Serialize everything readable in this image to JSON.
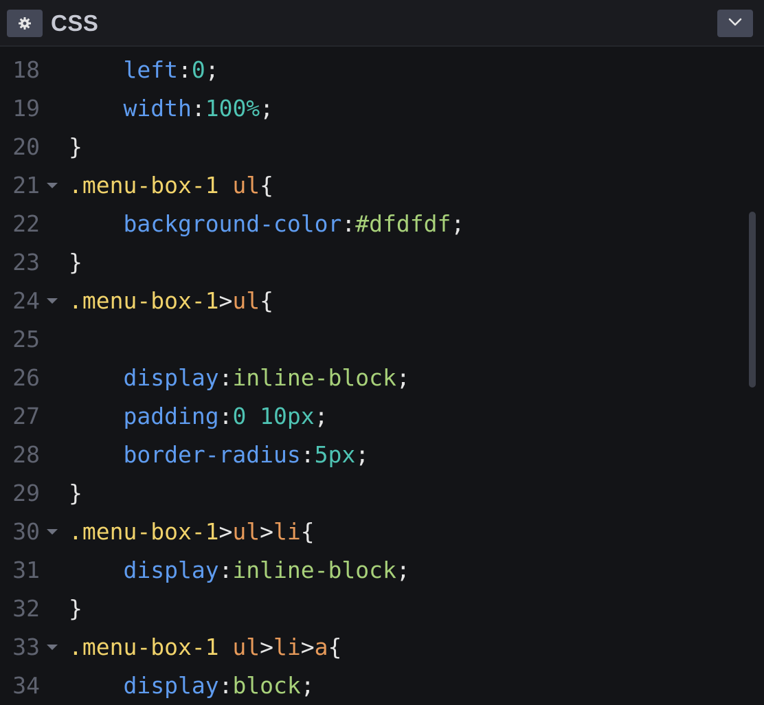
{
  "header": {
    "title": "CSS",
    "settings_icon": "gear-icon",
    "collapse_icon": "chevron-down-icon"
  },
  "colors": {
    "background": "#131417",
    "header": "#1a1b1f",
    "button": "#444857",
    "line_number": "#5f6370",
    "selector": "#f1d36b",
    "tag": "#e79a5a",
    "property": "#5f9cf0",
    "number": "#4fc4b4",
    "value": "#a8d17a",
    "punctuation": "#e6e6e6"
  },
  "code": {
    "lines": [
      {
        "num": "18",
        "fold": false,
        "tokens": [
          {
            "t": "    "
          },
          {
            "t": "left",
            "k": "prop"
          },
          {
            "t": ":",
            "k": "punc"
          },
          {
            "t": "0",
            "k": "num"
          },
          {
            "t": ";",
            "k": "punc"
          }
        ]
      },
      {
        "num": "19",
        "fold": false,
        "tokens": [
          {
            "t": "    "
          },
          {
            "t": "width",
            "k": "prop"
          },
          {
            "t": ":",
            "k": "punc"
          },
          {
            "t": "100%",
            "k": "num"
          },
          {
            "t": ";",
            "k": "punc"
          }
        ]
      },
      {
        "num": "20",
        "fold": false,
        "tokens": [
          {
            "t": "}",
            "k": "punc"
          }
        ]
      },
      {
        "num": "21",
        "fold": true,
        "tokens": [
          {
            "t": ".menu-box-1 ",
            "k": "sel"
          },
          {
            "t": "ul",
            "k": "tag"
          },
          {
            "t": "{",
            "k": "punc"
          }
        ]
      },
      {
        "num": "22",
        "fold": false,
        "tokens": [
          {
            "t": "    "
          },
          {
            "t": "background-color",
            "k": "prop"
          },
          {
            "t": ":",
            "k": "punc"
          },
          {
            "t": "#dfdfdf",
            "k": "val"
          },
          {
            "t": ";",
            "k": "punc"
          }
        ]
      },
      {
        "num": "23",
        "fold": false,
        "tokens": [
          {
            "t": "}",
            "k": "punc"
          }
        ]
      },
      {
        "num": "24",
        "fold": true,
        "tokens": [
          {
            "t": ".menu-box-1",
            "k": "sel"
          },
          {
            "t": ">",
            "k": "punc"
          },
          {
            "t": "ul",
            "k": "tag"
          },
          {
            "t": "{",
            "k": "punc"
          }
        ]
      },
      {
        "num": "25",
        "fold": false,
        "tokens": []
      },
      {
        "num": "26",
        "fold": false,
        "tokens": [
          {
            "t": "    "
          },
          {
            "t": "display",
            "k": "prop"
          },
          {
            "t": ":",
            "k": "punc"
          },
          {
            "t": "inline-block",
            "k": "val"
          },
          {
            "t": ";",
            "k": "punc"
          }
        ]
      },
      {
        "num": "27",
        "fold": false,
        "tokens": [
          {
            "t": "    "
          },
          {
            "t": "padding",
            "k": "prop"
          },
          {
            "t": ":",
            "k": "punc"
          },
          {
            "t": "0 10px",
            "k": "num"
          },
          {
            "t": ";",
            "k": "punc"
          }
        ]
      },
      {
        "num": "28",
        "fold": false,
        "tokens": [
          {
            "t": "    "
          },
          {
            "t": "border-radius",
            "k": "prop"
          },
          {
            "t": ":",
            "k": "punc"
          },
          {
            "t": "5px",
            "k": "num"
          },
          {
            "t": ";",
            "k": "punc"
          }
        ]
      },
      {
        "num": "29",
        "fold": false,
        "tokens": [
          {
            "t": "}",
            "k": "punc"
          }
        ]
      },
      {
        "num": "30",
        "fold": true,
        "tokens": [
          {
            "t": ".menu-box-1",
            "k": "sel"
          },
          {
            "t": ">",
            "k": "punc"
          },
          {
            "t": "ul",
            "k": "tag"
          },
          {
            "t": ">",
            "k": "punc"
          },
          {
            "t": "li",
            "k": "tag"
          },
          {
            "t": "{",
            "k": "punc"
          }
        ]
      },
      {
        "num": "31",
        "fold": false,
        "tokens": [
          {
            "t": "    "
          },
          {
            "t": "display",
            "k": "prop"
          },
          {
            "t": ":",
            "k": "punc"
          },
          {
            "t": "inline-block",
            "k": "val"
          },
          {
            "t": ";",
            "k": "punc"
          }
        ]
      },
      {
        "num": "32",
        "fold": false,
        "tokens": [
          {
            "t": "}",
            "k": "punc"
          }
        ]
      },
      {
        "num": "33",
        "fold": true,
        "tokens": [
          {
            "t": ".menu-box-1 ",
            "k": "sel"
          },
          {
            "t": "ul",
            "k": "tag"
          },
          {
            "t": ">",
            "k": "punc"
          },
          {
            "t": "li",
            "k": "tag"
          },
          {
            "t": ">",
            "k": "punc"
          },
          {
            "t": "a",
            "k": "tag"
          },
          {
            "t": "{",
            "k": "punc"
          }
        ]
      },
      {
        "num": "34",
        "fold": false,
        "tokens": [
          {
            "t": "    "
          },
          {
            "t": "display",
            "k": "prop"
          },
          {
            "t": ":",
            "k": "punc"
          },
          {
            "t": "block",
            "k": "val"
          },
          {
            "t": ";",
            "k": "punc"
          }
        ]
      }
    ]
  }
}
